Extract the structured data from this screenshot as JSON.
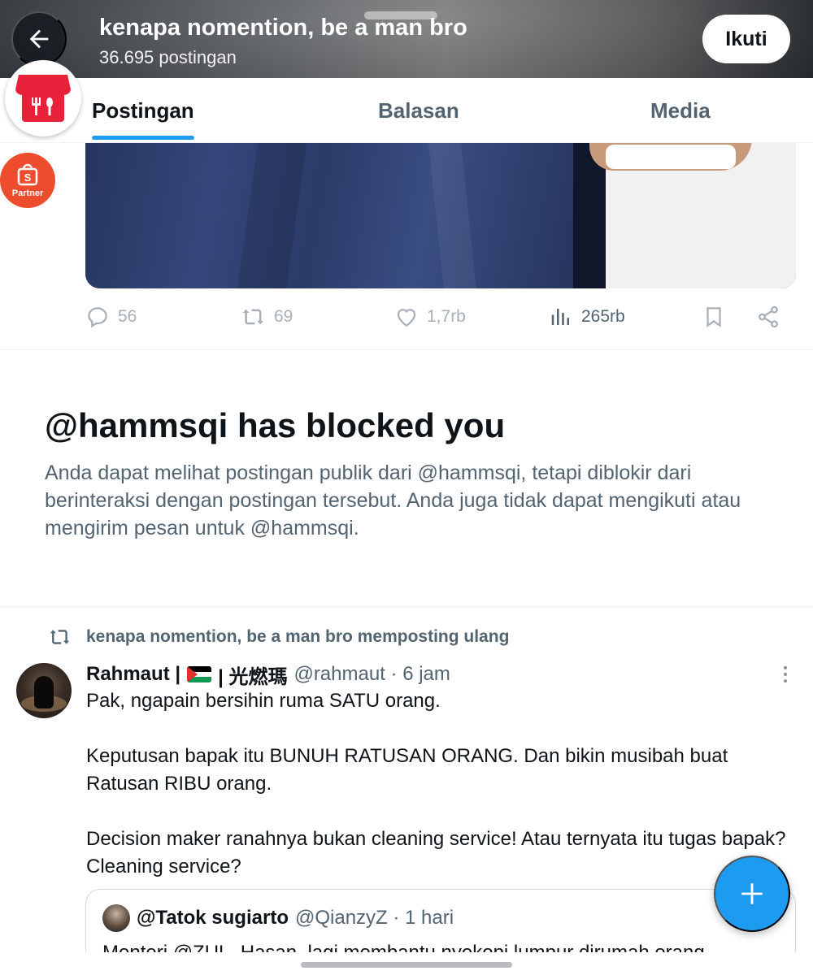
{
  "header": {
    "title": "kenapa nomention, be a man bro",
    "post_count": "36.695 postingan",
    "follow_label": "Ikuti",
    "back_icon": "arrow-left-icon"
  },
  "tabs": [
    {
      "label": "Postingan",
      "active": true
    },
    {
      "label": "Balasan",
      "active": false
    },
    {
      "label": "Media",
      "active": false
    }
  ],
  "badges": {
    "shop_icon": "food-store-icon",
    "partner_label": "Partner",
    "partner_letter": "S"
  },
  "post_actions": {
    "replies": "56",
    "reposts": "69",
    "likes": "1,7rb",
    "views": "265rb"
  },
  "blocked": {
    "title": "@hammsqi has blocked you",
    "body": "Anda dapat melihat postingan publik dari @hammsqi, tetapi diblokir dari berinteraksi dengan postingan tersebut. Anda juga tidak dapat mengikuti atau mengirim pesan untuk @hammsqi."
  },
  "repost": {
    "label": "kenapa nomention, be a man bro memposting ulang"
  },
  "tweet": {
    "name_part1": "Rahmaut |",
    "name_part2": "| 光燃瑪",
    "handle_time": "@rahmaut · 6 jam",
    "paragraphs": [
      "Pak, ngapain bersihin ruma SATU orang.",
      "Keputusan bapak itu BUNUH RATUSAN ORANG. Dan bikin musibah buat Ratusan RIBU orang.",
      "Decision maker ranahnya bukan cleaning service! Atau ternyata itu tugas bapak? Cleaning service?"
    ]
  },
  "quote": {
    "name": "@Tatok sugiarto",
    "handle_time": "@QianzyZ · 1 hari",
    "text": "Menteri @ZUL_Hasan, lagi membantu nyekopi lumpur dirumah orang."
  },
  "colors": {
    "accent": "#1d9bf0",
    "secondary_text": "#536471",
    "shop_red": "#e8213a",
    "partner_orange": "#ee4d2d"
  }
}
